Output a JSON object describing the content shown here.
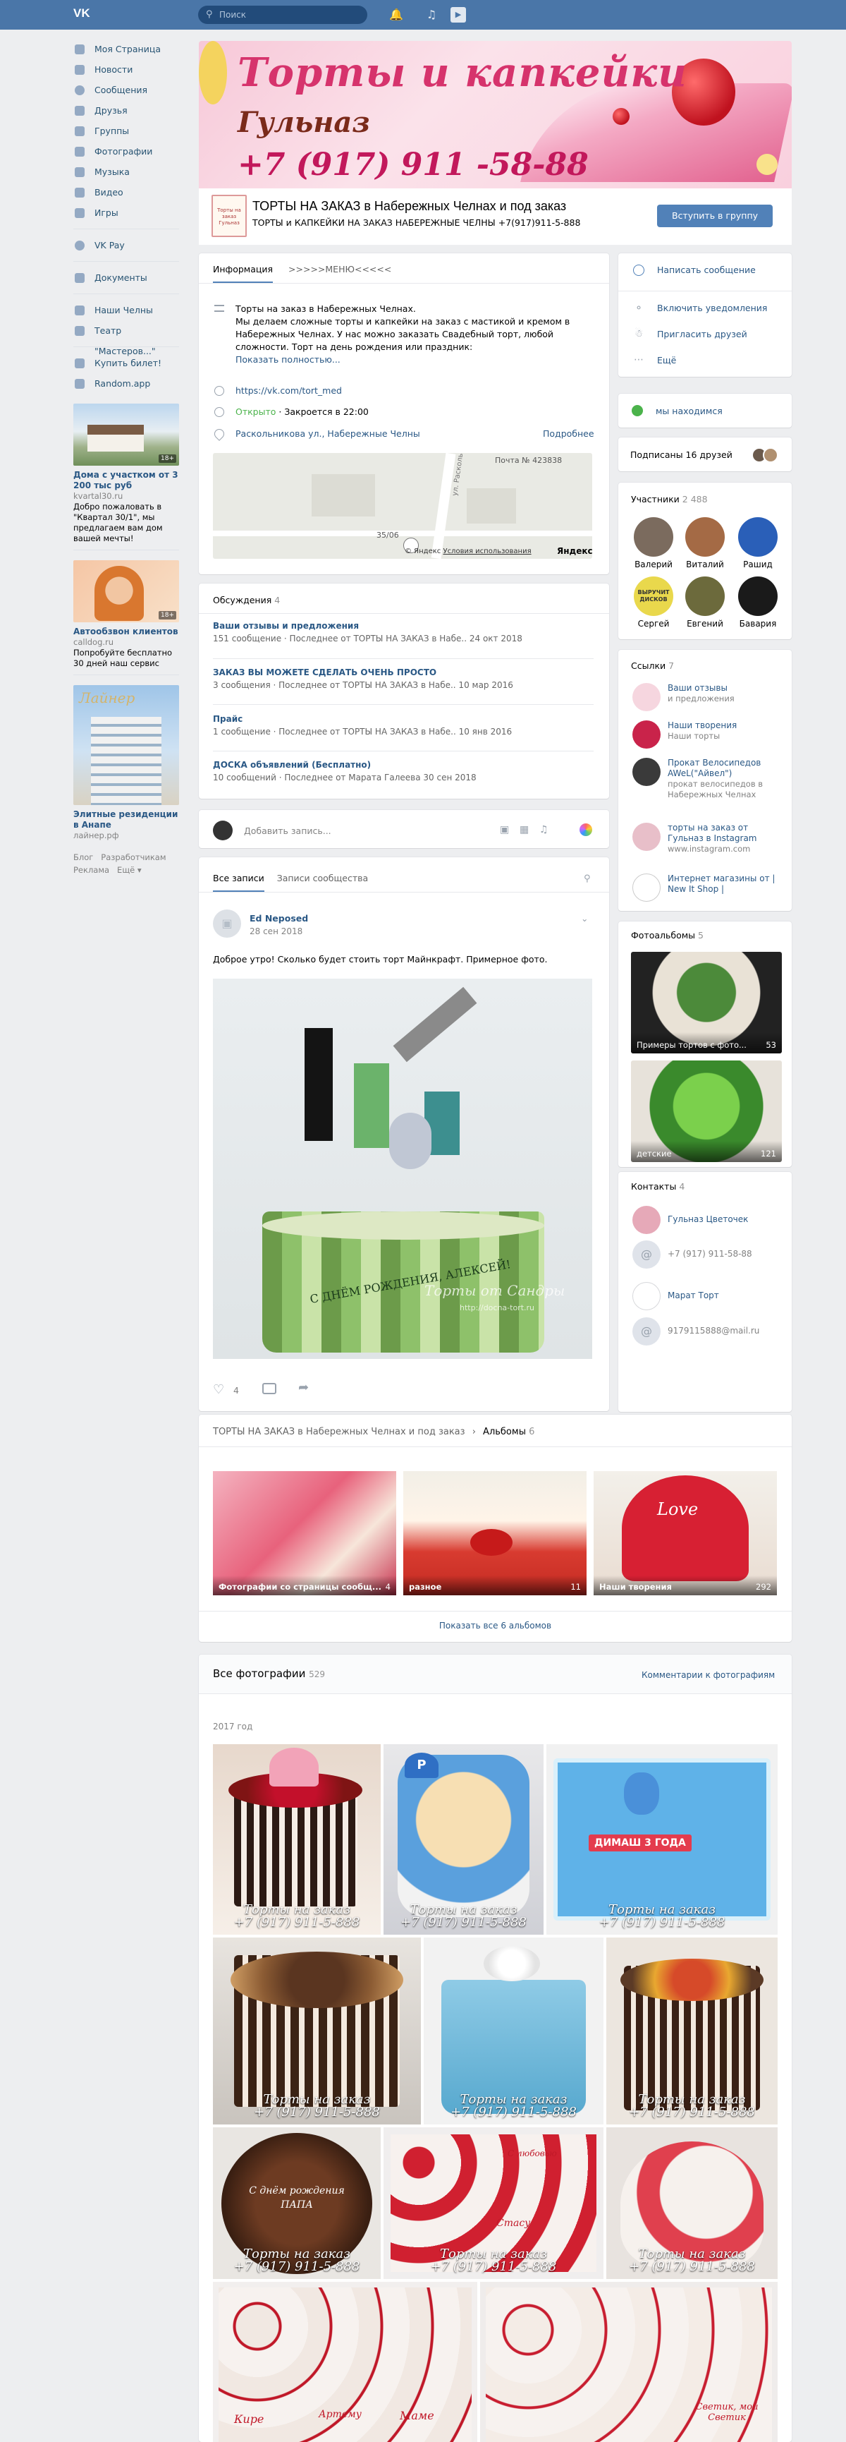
{
  "header": {
    "logo": "VK",
    "search_placeholder": "Поиск"
  },
  "sidebar": {
    "items": [
      {
        "label": "Моя Страница"
      },
      {
        "label": "Новости"
      },
      {
        "label": "Сообщения"
      },
      {
        "label": "Друзья"
      },
      {
        "label": "Группы"
      },
      {
        "label": "Фотографии"
      },
      {
        "label": "Музыка"
      },
      {
        "label": "Видео"
      },
      {
        "label": "Игры"
      }
    ],
    "items2": [
      {
        "label": "VK Pay"
      }
    ],
    "items3": [
      {
        "label": "Документы"
      }
    ],
    "items4": [
      {
        "label": "Наши Челны"
      },
      {
        "label": "Театр \"Мастеров...\""
      }
    ],
    "items5": [
      {
        "label": "Купить билет!"
      },
      {
        "label": "Random.app"
      }
    ],
    "ads": [
      {
        "badge": "18+",
        "title": "Дома с участком от 3 200 тыс руб",
        "domain": "kvartal30.ru",
        "text": "Добро пожаловать в \"Квартал 30/1\", мы предлагаем вам дом вашей мечты!"
      },
      {
        "badge": "18+",
        "title": "Автообзвон клиентов",
        "domain": "calldog.ru",
        "text": "Попробуйте бесплатно 30 дней наш сервис"
      },
      {
        "title": "Элитные резиденции в Анапе",
        "domain": "лайнер.рф",
        "brand": "Лайнер"
      }
    ],
    "footer": [
      "Блог",
      "Разработчикам",
      "Реклама",
      "Ещё"
    ]
  },
  "cover": {
    "line1": "Торты и капкейки",
    "line2": "Гульназ",
    "line3": "+7 (917) 911 -58-88"
  },
  "group": {
    "avatar_text": "Торты на заказ Гульназ",
    "name": "ТОРТЫ НА ЗАКАЗ в Набережных Челнах и под заказ",
    "status": "ТОРТЫ и КАПКЕЙКИ НА ЗАКАЗ НАБЕРЕЖНЫЕ ЧЕЛНЫ +7(917)911-5-888",
    "join_button": "Вступить в группу"
  },
  "info": {
    "tabs": [
      "Информация",
      ">>>>>МЕНЮ<<<<<"
    ],
    "description": [
      "Торты на заказ в Набережных Челнах.",
      "Мы делаем сложные торты и капкейки на заказ с мастикой и кремом в Набережных Челнах. У нас можно заказать Свадебный торт, любой сложности. Торт на день рождения или праздник:"
    ],
    "show_more": "Показать полностью...",
    "link": "https://vk.com/tort_med",
    "open": "Открыто",
    "closes": "· Закроется в 22:00",
    "address": "Раскольникова ул., Набережные Челны",
    "address_more": "Подробнее",
    "map": {
      "post": "Почта № 423838",
      "num": "35/06",
      "street": "ул. Раскольникова",
      "yandex": "© Яндекс",
      "terms": "Условия использования",
      "brand": "Яндекс"
    }
  },
  "discussions": {
    "title": "Обсуждения",
    "count": "4",
    "topics": [
      {
        "title": "Ваши отзывы и предложения",
        "meta": "151 сообщение · Последнее от ТОРТЫ НА ЗАКАЗ в Набе.. 24 окт 2018"
      },
      {
        "title": "ЗАКАЗ ВЫ МОЖЕТЕ СДЕЛАТЬ ОЧЕНЬ ПРОСТО",
        "meta": "3 сообщения · Последнее от ТОРТЫ НА ЗАКАЗ в Набе.. 10 мар 2016"
      },
      {
        "title": "Прайс",
        "meta": "1 сообщение · Последнее от ТОРТЫ НА ЗАКАЗ в Набе.. 10 янв 2016"
      },
      {
        "title": "ДОСКА объявлений (Бесплатно)",
        "meta": "10 сообщений · Последнее от Марата Галеева 30 сен 2018"
      }
    ]
  },
  "composer": {
    "placeholder": "Добавить запись..."
  },
  "wall": {
    "tabs": [
      "Все записи",
      "Записи сообщества"
    ],
    "post": {
      "author": "Ed Neposed",
      "date": "28 сен 2018",
      "text": "Доброе утро! Сколько будет стоить торт Майнкрафт. Примерное фото.",
      "watermark1": "С ДНЁМ РОЖДЕНИЯ, АЛЕКСЕЙ!",
      "watermark2": "Торты от Сандры",
      "watermark3": "http://docna-tort.ru",
      "likes": "4"
    }
  },
  "albums": {
    "group": "ТОРТЫ НА ЗАКАЗ в Набережных Челнах и под заказ",
    "title": "Альбомы",
    "count": "6",
    "items": [
      {
        "name": "Фотографии со страницы сообщ...",
        "count": "4"
      },
      {
        "name": "разное",
        "count": "11"
      },
      {
        "name": "Наши творения",
        "count": "292"
      }
    ],
    "show_all": "Показать все 6 альбомов"
  },
  "photos": {
    "title": "Все фотографии",
    "count": "529",
    "comments": "Комментарии к фотографиям",
    "year": "2017 год",
    "wm1": "Торты на заказ",
    "wm2": "+7 (917) 911-5-888",
    "labels": {
      "dimash": "ДИМАШ 3 ГОДА",
      "papa": "С днём рождения ПАПА",
      "stasu": "Стасу",
      "s_lyubovyu": "С любовью",
      "names": [
        "Кире",
        "Артему",
        "Маме",
        "Светик, мой Светик"
      ]
    }
  },
  "right": {
    "actions": [
      "Написать сообщение",
      "Включить уведомления",
      "Пригласить друзей",
      "Ещё"
    ],
    "location": "мы находимся",
    "friends": "Подписаны 16 друзей",
    "members": {
      "title": "Участники",
      "count": "2 488",
      "names": [
        "Валерий",
        "Виталий",
        "Рашид",
        "Сергей",
        "Евгений",
        "Бавария"
      ],
      "photo_text": "ВЫРУЧИТ ДИСКОВ"
    },
    "links": {
      "title": "Ссылки",
      "count": "7",
      "items": [
        {
          "title": "Ваши отзывы",
          "sub": "и предложения"
        },
        {
          "title": "Наши творения",
          "sub": "Наши торты"
        },
        {
          "title": "Прокат Велосипедов AWeL(\"Айвел\")",
          "sub": "прокат велосипедов в Набережных Челнах"
        },
        {
          "title": "торты на заказ от Гульназ в Instagram",
          "sub": "www.instagram.com"
        },
        {
          "title": "Интернет магазины от | New It Shop |",
          "sub": ""
        }
      ]
    },
    "photo_albums": {
      "title": "Фотоальбомы",
      "count": "5",
      "items": [
        {
          "name": "Примеры тортов с фото...",
          "count": "53"
        },
        {
          "name": "детские",
          "count": "121"
        }
      ]
    },
    "contacts": {
      "title": "Контакты",
      "count": "4",
      "items": [
        {
          "name": "Гульназ Цветочек"
        },
        {
          "name": "+7 (917) 911-58-88"
        },
        {
          "name": "Марат Торт"
        },
        {
          "name": "9179115888@mail.ru"
        }
      ]
    }
  }
}
